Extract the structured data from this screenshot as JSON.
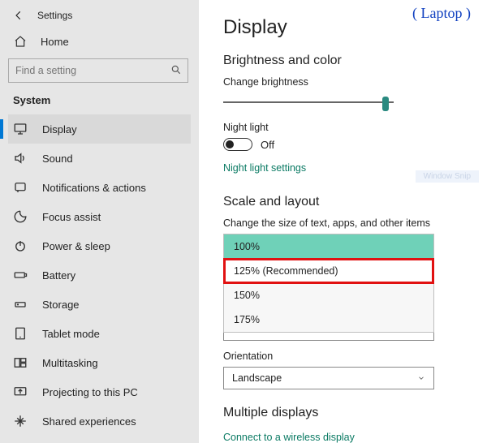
{
  "annotation": "( Laptop )",
  "window": {
    "title_label": "Settings"
  },
  "sidebar": {
    "home_label": "Home",
    "search_placeholder": "Find a setting",
    "section_label": "System",
    "items": [
      {
        "label": "Display"
      },
      {
        "label": "Sound"
      },
      {
        "label": "Notifications & actions"
      },
      {
        "label": "Focus assist"
      },
      {
        "label": "Power & sleep"
      },
      {
        "label": "Battery"
      },
      {
        "label": "Storage"
      },
      {
        "label": "Tablet mode"
      },
      {
        "label": "Multitasking"
      },
      {
        "label": "Projecting to this PC"
      },
      {
        "label": "Shared experiences"
      }
    ]
  },
  "main": {
    "page_title": "Display",
    "section_brightness": "Brightness and color",
    "brightness_label": "Change brightness",
    "brightness_value_pct": 95,
    "night_light_label": "Night light",
    "night_light_state": "Off",
    "night_light_settings_link": "Night light settings",
    "section_scale": "Scale and layout",
    "scale_label": "Change the size of text, apps, and other items",
    "scale_options": [
      "100%",
      "125% (Recommended)",
      "150%",
      "175%"
    ],
    "scale_selected": "100%",
    "scale_highlighted": "125% (Recommended)",
    "orientation_label": "Orientation",
    "orientation_value": "Landscape",
    "section_multiple": "Multiple displays",
    "connect_link": "Connect to a wireless display"
  },
  "overlay": {
    "snip_label": "Window Snip"
  }
}
